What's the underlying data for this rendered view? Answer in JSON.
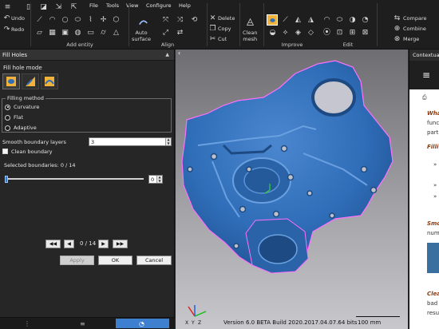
{
  "toolbar": {
    "history": {
      "undo": "Undo",
      "redo": "Redo"
    },
    "menu": [
      "File",
      "Tools",
      "View",
      "Configure",
      "Help"
    ],
    "add_entity_label": "Add entity",
    "align": {
      "auto_surface": "Auto\nsurface",
      "label": "Align"
    },
    "edit_buttons": {
      "delete": "Delete",
      "copy": "Copy",
      "cut": "Cut"
    },
    "clean_mesh": "Clean\nmesh",
    "improve_label": "Improve",
    "edit_label": "Edit",
    "right_buttons": {
      "compare": "Compare",
      "combine": "Combine",
      "merge": "Merge"
    }
  },
  "panel": {
    "title": "Fill Holes",
    "mode_title": "Fill hole mode",
    "filling_method_title": "Filling method",
    "filling_methods": [
      "Curvature",
      "Flat",
      "Adaptive"
    ],
    "selected_method": "Curvature",
    "smooth_layers_label": "Smooth boundary layers",
    "smooth_layers_value": "3",
    "clean_boundary_label": "Clean boundary",
    "clean_boundary_checked": false,
    "selected_boundaries_text": "Selected boundaries: 0 / 14",
    "slider_value": "0",
    "slider_fraction": 0,
    "nav_count": "0 / 14",
    "apply": "Apply",
    "ok": "OK",
    "cancel": "Cancel"
  },
  "viewport": {
    "version": "Version 6.0 BETA Build 2020.2017.04.07.64  bits",
    "scale": "100 mm",
    "axes": {
      "x": "X",
      "y": "Y",
      "z": "Z"
    }
  },
  "right_panel": {
    "title": "Contextual",
    "lines": [
      "Wha",
      "func",
      "parti",
      "Filli",
      "»",
      "»",
      "»",
      "Smo",
      "num",
      "Clea",
      "bad",
      "resu"
    ]
  },
  "colors": {
    "mesh": "#2f6db8",
    "accent": "#2a7ad8",
    "highlight_border": "#ff66ff"
  }
}
